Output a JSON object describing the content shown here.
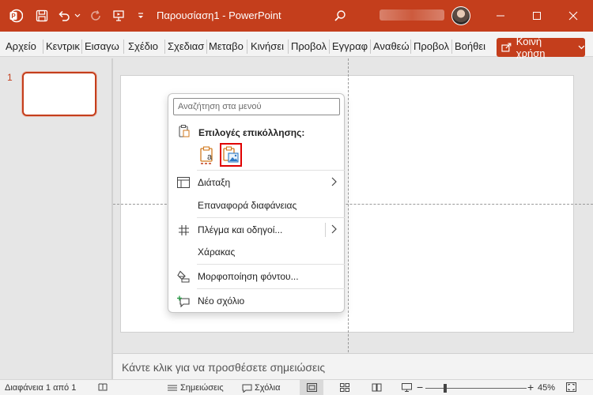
{
  "titlebar": {
    "title": "Παρουσίαση1 - PowerPoint",
    "icons": [
      "powerpoint-logo",
      "save-icon",
      "undo-icon",
      "redo-icon",
      "present-icon",
      "customize-qat-icon",
      "search-icon"
    ],
    "window_controls": [
      "minimize",
      "maximize",
      "close"
    ],
    "accent_color": "#c43e1c"
  },
  "ribbon": {
    "tabs": [
      "Αρχείο",
      "Κεντρικ",
      "Εισαγω",
      "Σχέδιο",
      "Σχεδιασ",
      "Μεταβο",
      "Κινήσει",
      "Προβολ",
      "Εγγραφ",
      "Αναθεώ",
      "Προβολ",
      "Βοήθει"
    ],
    "share_label": "Κοινή χρήση"
  },
  "thumbnails": {
    "slide_number": "1"
  },
  "notes": {
    "placeholder": "Κάντε κλικ για να προσθέσετε σημειώσεις"
  },
  "context_menu": {
    "search_placeholder": "Αναζήτηση στα μενού",
    "paste_header": "Επιλογές επικόλλησης:",
    "items": [
      {
        "label": "Διάταξη",
        "icon": "layout-icon"
      },
      {
        "label": "Επαναφορά διαφάνειας",
        "icon": ""
      },
      {
        "label": "Πλέγμα και οδηγοί...",
        "icon": "grid-icon"
      },
      {
        "label": "Χάρακας",
        "icon": ""
      },
      {
        "label": "Μορφοποίηση φόντου...",
        "icon": "format-background-icon"
      },
      {
        "label": "Νέο σχόλιο",
        "icon": "new-comment-icon"
      }
    ]
  },
  "statusbar": {
    "slide_count": "Διαφάνεια 1 από 1",
    "notes_label": "Σημειώσεις",
    "comments_label": "Σχόλια",
    "zoom": "45%",
    "zoom_value": 45
  }
}
